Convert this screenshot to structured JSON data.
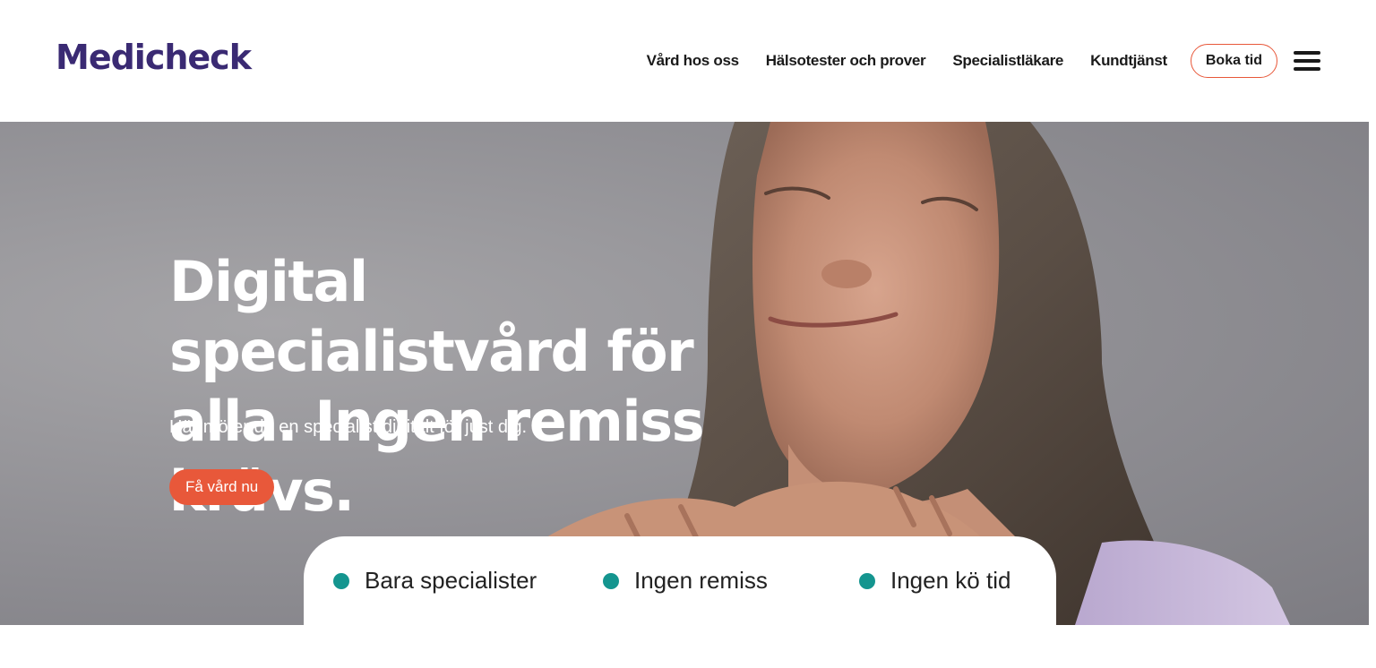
{
  "brand": {
    "logo_text": "Medicheck"
  },
  "nav": {
    "links": [
      "Vård hos oss",
      "Hälsotester och prover",
      "Specialistläkare",
      "Kundtjänst"
    ],
    "book_label": "Boka tid",
    "menu_icon": "hamburger-icon"
  },
  "hero": {
    "title": "Digital specialistvård för alla. Ingen remiss krävs.",
    "subtitle": "Här möter du en specialist digitalt för just dig.",
    "cta_label": "Få vård nu",
    "image": "woman-eyes-closed-hands-on-neck"
  },
  "usps": [
    "Bara specialister",
    "Ingen remiss",
    "Ingen kö tid"
  ],
  "colors": {
    "brand_purple": "#3a2a73",
    "accent_orange": "#e8583a",
    "bullet_teal": "#14958f"
  }
}
